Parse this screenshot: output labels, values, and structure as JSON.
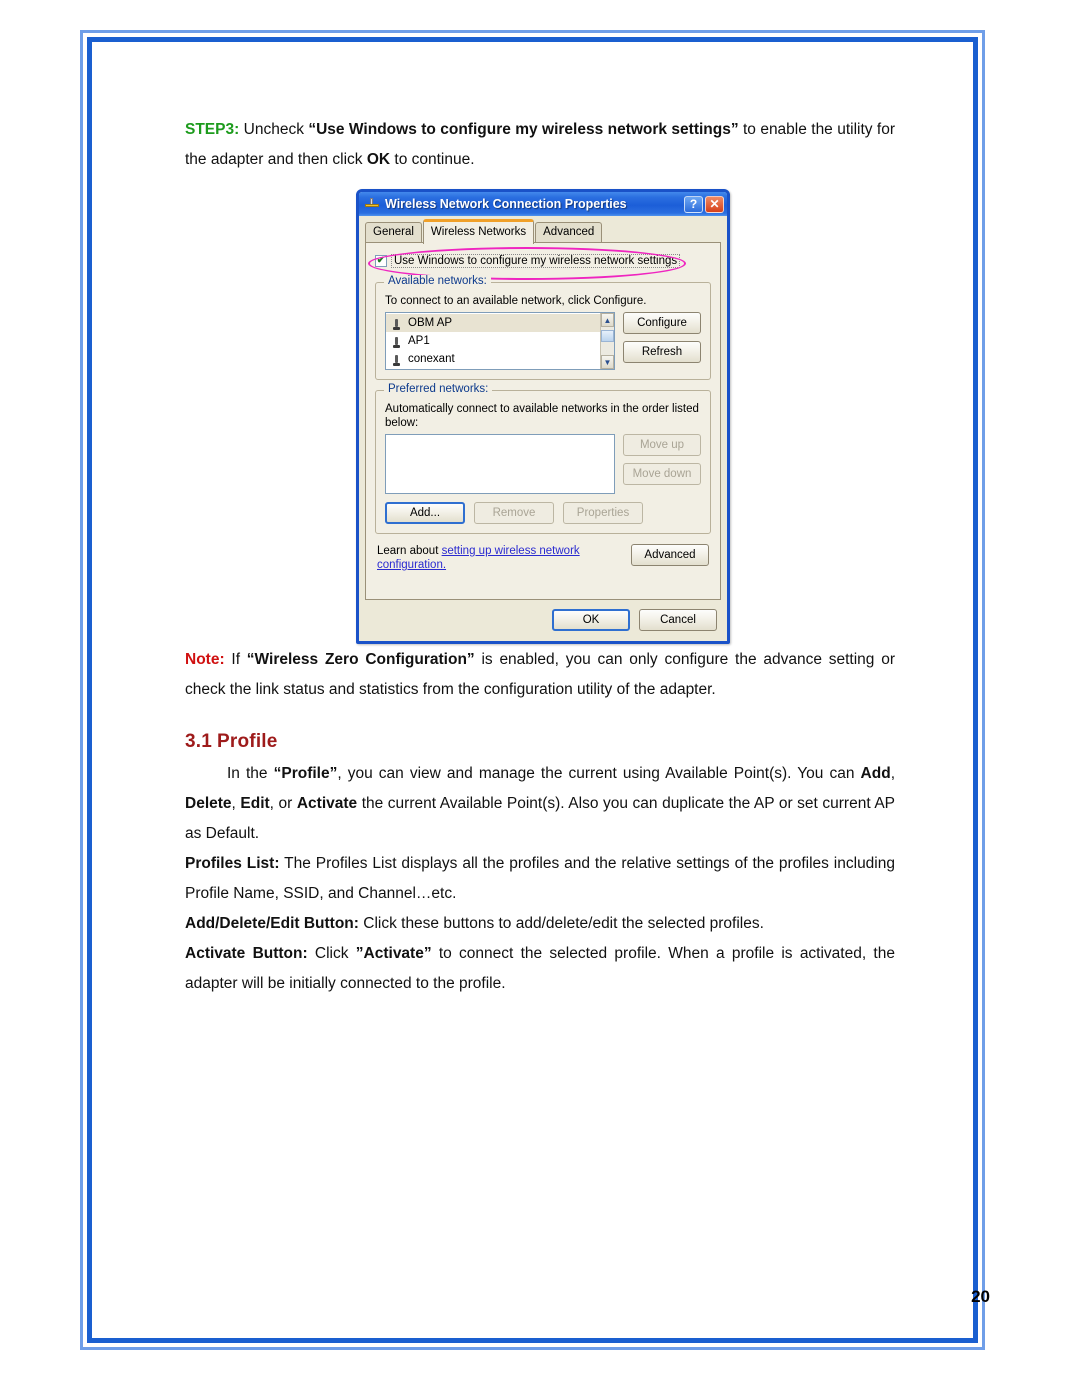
{
  "page": {
    "number": "20",
    "border_color": "#1a5fd0"
  },
  "step": {
    "label": "STEP3:",
    "label_color": "#1d9b1d",
    "text_before": " Uncheck ",
    "quoted_bold": "“Use Windows to configure my wireless network settings”",
    "text_after": " to enable the utility for the adapter and then click ",
    "ok_bold": "OK",
    "text_end": " to continue."
  },
  "note": {
    "label": "Note:",
    "label_color": "#d01010",
    "text_before": " If ",
    "quoted_bold": "“Wireless Zero Configuration”",
    "text_after": " is enabled, you can only configure the advance setting or check the link status and statistics from the configuration utility of the adapter."
  },
  "section": {
    "number": "3.1",
    "title": "Profile",
    "title_color": "#9e1b1b",
    "paragraphs": [
      {
        "indent": true,
        "runs": [
          {
            "t": "In the ",
            "b": false
          },
          {
            "t": "“Profile”",
            "b": true
          },
          {
            "t": ", you can view and manage the current using Available Point(s). You can ",
            "b": false
          },
          {
            "t": "Add",
            "b": true
          },
          {
            "t": ", ",
            "b": false
          },
          {
            "t": "Delete",
            "b": true
          },
          {
            "t": ", ",
            "b": false
          },
          {
            "t": "Edit",
            "b": true
          },
          {
            "t": ", or ",
            "b": false
          },
          {
            "t": "Activate",
            "b": true
          },
          {
            "t": " the current Available Point(s). Also you can duplicate the AP or set current AP as Default.",
            "b": false
          }
        ]
      },
      {
        "indent": false,
        "runs": [
          {
            "t": "Profiles List:",
            "b": true
          },
          {
            "t": " The Profiles List displays all the profiles and the relative settings of the profiles including Profile Name, SSID, and Channel…etc.",
            "b": false
          }
        ]
      },
      {
        "indent": false,
        "runs": [
          {
            "t": "Add/Delete/Edit Button:",
            "b": true
          },
          {
            "t": " Click these buttons to add/delete/edit the selected profiles.",
            "b": false
          }
        ]
      },
      {
        "indent": false,
        "runs": [
          {
            "t": "Activate Button:",
            "b": true
          },
          {
            "t": " Click ",
            "b": false
          },
          {
            "t": "”Activate”",
            "b": true
          },
          {
            "t": " to connect the selected profile. When a profile is activated, the adapter will be initially connected to the profile.",
            "b": false
          }
        ]
      }
    ]
  },
  "dialog": {
    "title": "Wireless Network Connection Properties",
    "titlebar_icon": "network-connection-icon",
    "help_button": "?",
    "close_button": "✕",
    "tabs": [
      {
        "label": "General",
        "active": false
      },
      {
        "label": "Wireless Networks",
        "active": true
      },
      {
        "label": "Advanced",
        "active": false
      }
    ],
    "use_windows_checkbox": {
      "label": "Use Windows to configure my wireless network settings",
      "checked": true,
      "check_glyph": "✔",
      "annotation_color": "#ef25c0"
    },
    "available_networks": {
      "group_title": "Available networks:",
      "description": "To connect to an available network, click Configure.",
      "items": [
        {
          "name": "OBM AP",
          "selected": true
        },
        {
          "name": "AP1",
          "selected": false
        },
        {
          "name": "conexant",
          "selected": false
        }
      ],
      "buttons": [
        {
          "label": "Configure",
          "disabled": false
        },
        {
          "label": "Refresh",
          "disabled": false
        }
      ],
      "scroll_up": "▲",
      "scroll_down": "▼"
    },
    "preferred_networks": {
      "group_title": "Preferred networks:",
      "description": "Automatically connect to available networks in the order listed below:",
      "items": [],
      "side_buttons": [
        {
          "label": "Move up",
          "disabled": true
        },
        {
          "label": "Move down",
          "disabled": true
        }
      ],
      "bottom_buttons": [
        {
          "label": "Add...",
          "disabled": false
        },
        {
          "label": "Remove",
          "disabled": true
        },
        {
          "label": "Properties",
          "disabled": true
        }
      ]
    },
    "learn": {
      "prefix": "Learn about ",
      "link": "setting up wireless network configuration.",
      "advanced_button": "Advanced"
    },
    "footer_buttons": [
      {
        "label": "OK",
        "default": true
      },
      {
        "label": "Cancel",
        "default": false
      }
    ]
  }
}
